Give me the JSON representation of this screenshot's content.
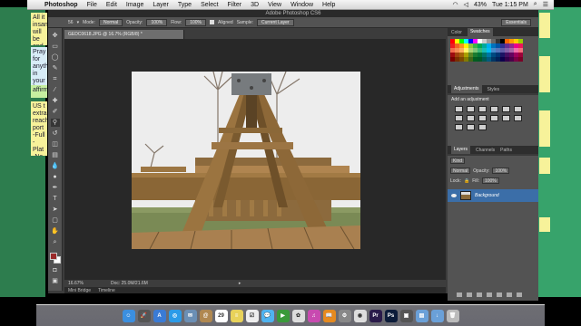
{
  "menubar": {
    "app_name": "Photoshop",
    "items": [
      "File",
      "Edit",
      "Image",
      "Layer",
      "Type",
      "Select",
      "Filter",
      "3D",
      "View",
      "Window",
      "Help"
    ],
    "battery": "43%",
    "clock": "Tue 1:15 PM"
  },
  "window": {
    "title": "Adobe Photoshop CS6"
  },
  "options_bar": {
    "mode_label": "Mode:",
    "mode_value": "Normal",
    "opacity_label": "Opacity:",
    "opacity_value": "100%",
    "flow_label": "Flow:",
    "flow_value": "100%",
    "aligned_label": "Aligned",
    "sample_label": "Sample:",
    "sample_value": "Current Layer",
    "workspace": "Essentials",
    "brush_size": "56"
  },
  "document": {
    "tab_label": "GEDC0618.JPG @ 16.7% (RGB/8) *",
    "zoom": "16.67%",
    "doc_size": "Doc: 25.0M/21.6M"
  },
  "bottom_tabs": [
    "Mini Bridge",
    "Timeline"
  ],
  "panels": {
    "color_tabs": [
      "Color",
      "Swatches"
    ],
    "adjust_tabs": [
      "Adjustments",
      "Styles"
    ],
    "adjust_title": "Add an adjustment",
    "layers_tabs": [
      "Layers",
      "Channels",
      "Paths"
    ],
    "kind_label": "Kind",
    "blend_mode": "Normal",
    "opacity_label": "Opacity:",
    "opacity_value": "100%",
    "lock_label": "Lock:",
    "fill_label": "Fill:",
    "fill_value": "100%",
    "layer_name": "Background"
  },
  "notes": {
    "note1": "All it insane will be and in focus",
    "note2": "Pray for anything in your focus",
    "note3": "US t extra reach port -Full -Plat -Na -ap",
    "note4": "affirm"
  },
  "swatch_colors": [
    "#ff0000",
    "#ffff00",
    "#00ff00",
    "#00ffff",
    "#0000ff",
    "#ff00ff",
    "#ffffff",
    "#cccccc",
    "#999999",
    "#666666",
    "#333333",
    "#000000",
    "#ff6600",
    "#ff9900",
    "#ffcc00",
    "#99cc00",
    "#ee1c24",
    "#f26522",
    "#f7941d",
    "#fff200",
    "#8dc63f",
    "#39b54a",
    "#00a651",
    "#00a99d",
    "#00aeef",
    "#0072bc",
    "#0054a6",
    "#2e3192",
    "#662d91",
    "#92278f",
    "#ec008c",
    "#ed145b",
    "#f26c4f",
    "#f68e56",
    "#fbaf5d",
    "#fff568",
    "#acd373",
    "#7cc576",
    "#3bb878",
    "#1abbb4",
    "#00bff3",
    "#438ccb",
    "#5574b9",
    "#605ca8",
    "#855fa8",
    "#a763a8",
    "#f06eaa",
    "#f26d7d",
    "#9e0b0f",
    "#a0410d",
    "#a36209",
    "#aba000",
    "#598527",
    "#1a7b30",
    "#007236",
    "#00746b",
    "#0076a3",
    "#004a80",
    "#003471",
    "#1b1464",
    "#440e62",
    "#630460",
    "#9e005d",
    "#9e0039",
    "#790000",
    "#7b2e00",
    "#7d4900",
    "#827b00",
    "#406618",
    "#005e20",
    "#005826",
    "#005952",
    "#005b7f",
    "#003663",
    "#002157",
    "#0d004c",
    "#32004b",
    "#4b0049",
    "#7b0046",
    "#7a0026"
  ],
  "dock_icons": [
    {
      "name": "finder-icon",
      "color": "#3b8fe0",
      "glyph": "☺"
    },
    {
      "name": "launchpad-icon",
      "color": "#555",
      "glyph": "🚀"
    },
    {
      "name": "appstore-icon",
      "color": "#3a7bd5",
      "glyph": "A"
    },
    {
      "name": "safari-icon",
      "color": "#2b9be8",
      "glyph": "◎"
    },
    {
      "name": "mail-icon",
      "color": "#6b8fb5",
      "glyph": "✉"
    },
    {
      "name": "contacts-icon",
      "color": "#b08850",
      "glyph": "@"
    },
    {
      "name": "calendar-icon",
      "color": "#ffffff",
      "glyph": "29"
    },
    {
      "name": "notes-icon",
      "color": "#e8d25a",
      "glyph": "≡"
    },
    {
      "name": "reminders-icon",
      "color": "#eeeeee",
      "glyph": "☑"
    },
    {
      "name": "messages-icon",
      "color": "#4fb3f0",
      "glyph": "💬"
    },
    {
      "name": "facetime-icon",
      "color": "#3a9a3a",
      "glyph": "▶"
    },
    {
      "name": "photos-icon",
      "color": "#dddddd",
      "glyph": "✿"
    },
    {
      "name": "itunes-icon",
      "color": "#c84ab0",
      "glyph": "♫"
    },
    {
      "name": "ibooks-icon",
      "color": "#e58a1f",
      "glyph": "📖"
    },
    {
      "name": "preferences-icon",
      "color": "#888888",
      "glyph": "⚙"
    },
    {
      "name": "chrome-icon",
      "color": "#dddddd",
      "glyph": "◉"
    },
    {
      "name": "premiere-icon",
      "color": "#2a1a4a",
      "glyph": "Pr"
    },
    {
      "name": "photoshop-icon",
      "color": "#0c1c3a",
      "glyph": "Ps"
    },
    {
      "name": "screen-icon",
      "color": "#555555",
      "glyph": "▣"
    },
    {
      "name": "folder-icon",
      "color": "#6aa0d8",
      "glyph": "▤"
    },
    {
      "name": "downloads-icon",
      "color": "#6aa0d8",
      "glyph": "↓"
    },
    {
      "name": "trash-icon",
      "color": "#bbbbbb",
      "glyph": "🗑"
    }
  ]
}
